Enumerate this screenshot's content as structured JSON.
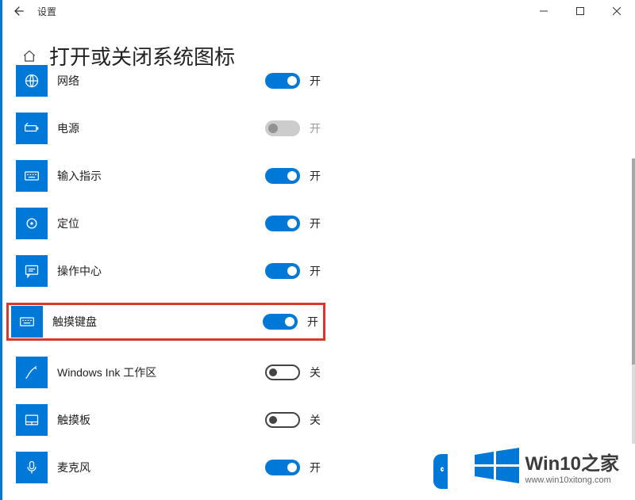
{
  "titlebar": {
    "title": "设置"
  },
  "page": {
    "title": "打开或关闭系统图标"
  },
  "state_labels": {
    "on": "开",
    "off": "关"
  },
  "items": [
    {
      "id": "network",
      "label": "网络",
      "state": "on",
      "state_text": "开",
      "icon": "globe"
    },
    {
      "id": "power",
      "label": "电源",
      "state": "disabled",
      "state_text": "开",
      "icon": "battery"
    },
    {
      "id": "input-indicator",
      "label": "输入指示",
      "state": "on",
      "state_text": "开",
      "icon": "keyboard"
    },
    {
      "id": "location",
      "label": "定位",
      "state": "on",
      "state_text": "开",
      "icon": "target"
    },
    {
      "id": "action-center",
      "label": "操作中心",
      "state": "on",
      "state_text": "开",
      "icon": "comment"
    },
    {
      "id": "touch-keyboard",
      "label": "触摸键盘",
      "state": "on",
      "state_text": "开",
      "icon": "keyboard",
      "highlight": true
    },
    {
      "id": "windows-ink",
      "label": "Windows Ink 工作区",
      "state": "off",
      "state_text": "关",
      "icon": "pen"
    },
    {
      "id": "touchpad",
      "label": "触摸板",
      "state": "off",
      "state_text": "关",
      "icon": "touchpad"
    },
    {
      "id": "microphone",
      "label": "麦克风",
      "state": "on",
      "state_text": "开",
      "icon": "mic"
    }
  ],
  "watermark": {
    "main": "Win10之家",
    "url": "www.win10xitong.com"
  }
}
